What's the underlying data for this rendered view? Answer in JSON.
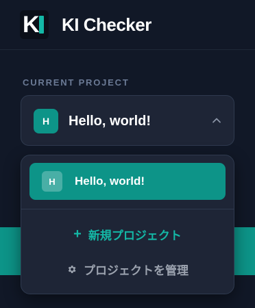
{
  "app": {
    "title": "KI Checker",
    "logo": {
      "letter": "K",
      "accent_color": "#14b8a6"
    }
  },
  "sidebar": {
    "section_label": "CURRENT PROJECT",
    "current_project": {
      "initial": "H",
      "name": "Hello, world!",
      "chevron": "chevron-up-icon"
    },
    "dropdown": {
      "items": [
        {
          "initial": "H",
          "name": "Hello, world!",
          "selected": true
        }
      ],
      "new_project_label": "新規プロジェクト",
      "new_project_icon": "plus-icon",
      "manage_label": "プロジェクトを管理",
      "manage_icon": "gear-icon"
    }
  },
  "colors": {
    "background": "#111827",
    "panel": "#1e2536",
    "accent": "#0d9488",
    "muted_text": "#9ca3af"
  }
}
